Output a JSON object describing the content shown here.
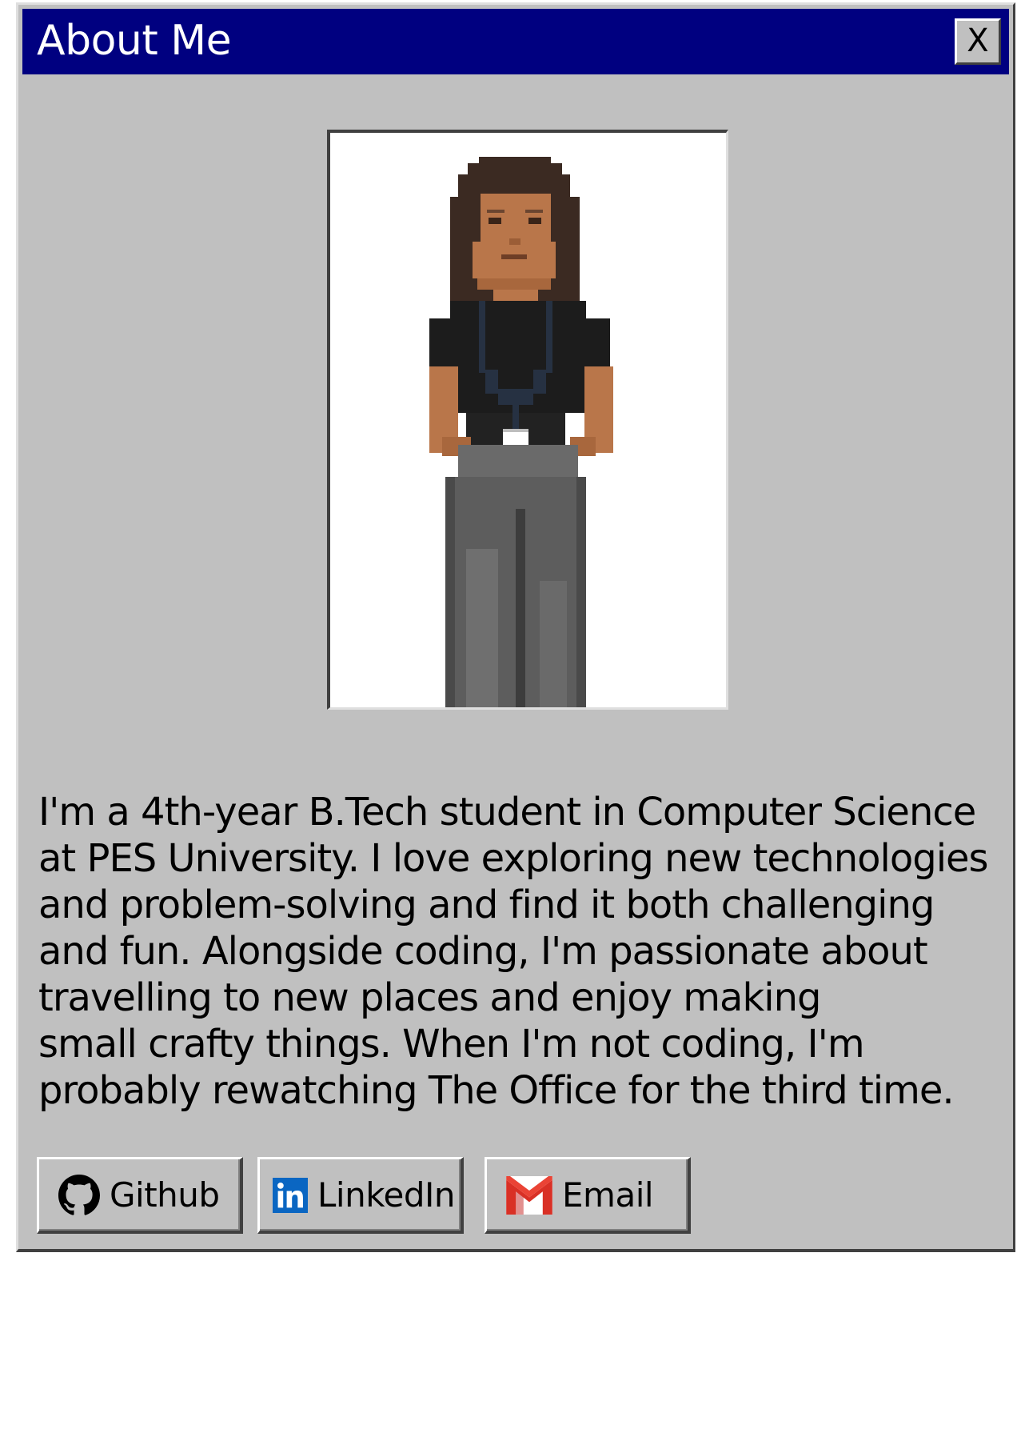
{
  "window": {
    "title": "About Me",
    "close_label": "X"
  },
  "bio": {
    "text": "I'm a 4th-year B.Tech student in Computer Science\nat PES University. I love exploring new technologies\nand problem-solving and find it both challenging\nand fun. Alongside coding, I'm passionate about\ntravelling to new places and enjoy making\nsmall crafty things. When I'm not coding, I'm\nprobably rewatching The Office for the third time."
  },
  "links": {
    "github": {
      "label": "Github",
      "icon": "github-icon"
    },
    "linkedin": {
      "label": "LinkedIn",
      "icon": "linkedin-icon"
    },
    "email": {
      "label": "Email",
      "icon": "gmail-icon"
    }
  },
  "colors": {
    "titlebar": "#000080",
    "window_bg": "#c0c0c0",
    "linkedin_blue": "#0a66c2",
    "gmail_red": "#d93025"
  }
}
